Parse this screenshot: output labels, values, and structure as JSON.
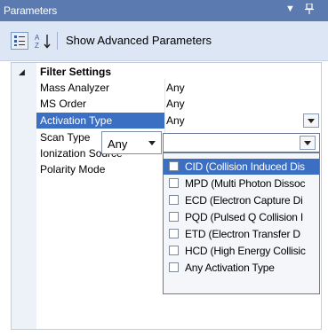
{
  "panel": {
    "title": "Parameters",
    "dropdown_glyph": "▼",
    "pin_glyph": "📌"
  },
  "toolbar": {
    "categorized_icon": "categorized-icon",
    "alphabetical_icon": "sort-alphabetical-icon",
    "show_advanced_label": "Show Advanced Parameters"
  },
  "grid": {
    "category": {
      "label": "Filter Settings",
      "expander": "◢"
    },
    "properties": [
      {
        "name": "Mass Analyzer",
        "value": "Any"
      },
      {
        "name": "MS Order",
        "value": "Any"
      },
      {
        "name": "Activation Type",
        "value": "Any",
        "selected": true
      },
      {
        "name": "Scan Type",
        "value": "Any"
      },
      {
        "name": "Ionization Source",
        "value": ""
      },
      {
        "name": "Polarity Mode",
        "value": ""
      }
    ]
  },
  "scan_type_combo": {
    "value": "Any"
  },
  "activation_dropdown": {
    "items": [
      {
        "label": "CID (Collision Induced Dis",
        "highlighted": true,
        "checked": false
      },
      {
        "label": "MPD (Multi Photon Dissoc",
        "highlighted": false,
        "checked": false
      },
      {
        "label": "ECD (Electron Capture Di",
        "highlighted": false,
        "checked": false
      },
      {
        "label": "PQD (Pulsed Q Collision I",
        "highlighted": false,
        "checked": false
      },
      {
        "label": "ETD (Electron Transfer D",
        "highlighted": false,
        "checked": false
      },
      {
        "label": "HCD (High Energy Collisic",
        "highlighted": false,
        "checked": false
      },
      {
        "label": "Any Activation Type",
        "highlighted": false,
        "checked": false
      }
    ]
  },
  "colors": {
    "title_bar": "#5b7bb0",
    "selection": "#3a6fc4",
    "toolbar": "#dde6f4"
  }
}
